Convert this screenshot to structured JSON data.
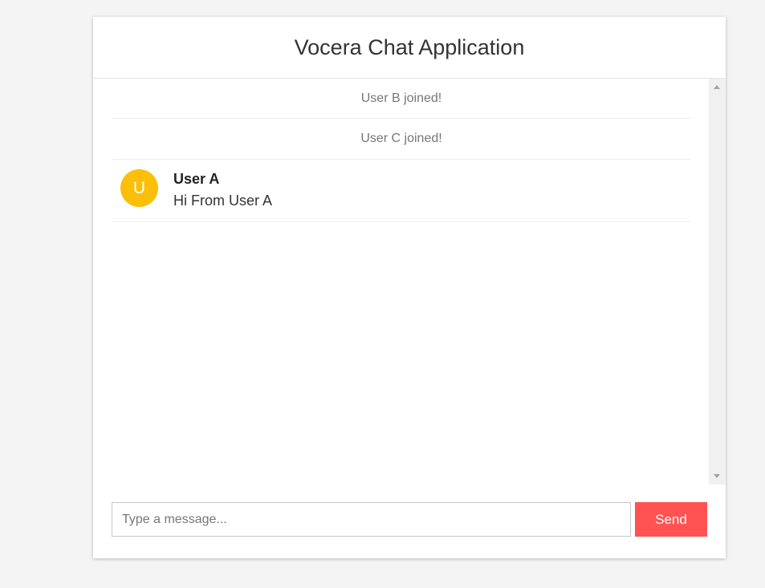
{
  "app": {
    "title": "Vocera Chat Application"
  },
  "messages": [
    {
      "type": "system",
      "text": "User B joined!"
    },
    {
      "type": "system",
      "text": "User C joined!"
    },
    {
      "type": "chat",
      "avatar_initial": "U",
      "author": "User A",
      "text": "Hi From User A"
    }
  ],
  "composer": {
    "placeholder": "Type a message...",
    "value": "",
    "send_label": "Send"
  },
  "colors": {
    "accent": "#ff5252",
    "avatar": "#fbbf09",
    "background": "#f4f4f4"
  }
}
